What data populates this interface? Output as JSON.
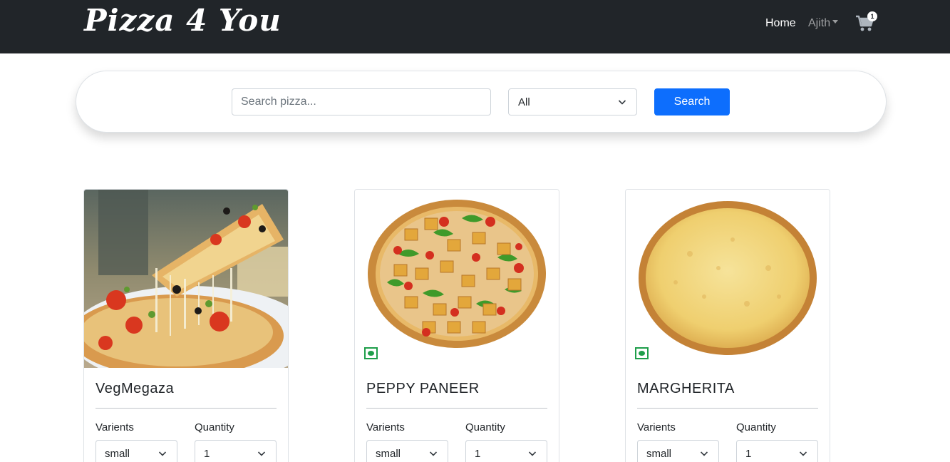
{
  "navbar": {
    "brand": "Pizza 4 You",
    "home": "Home",
    "user": "Ajith",
    "cart_count": "1"
  },
  "search": {
    "placeholder": "Search pizza...",
    "filter_value": "All",
    "button": "Search"
  },
  "labels": {
    "variants": "Varients",
    "quantity": "Quantity"
  },
  "pizzas": [
    {
      "name": "VegMegaza",
      "variant": "small",
      "quantity": "1",
      "image": "pizza-slice-photo",
      "veg_mark": false
    },
    {
      "name": "PEPPY PANEER",
      "variant": "small",
      "quantity": "1",
      "image": "paneer-pizza",
      "veg_mark": true
    },
    {
      "name": "MARGHERITA",
      "variant": "small",
      "quantity": "1",
      "image": "cheese-pizza",
      "veg_mark": true
    }
  ],
  "colors": {
    "navbar": "#212529",
    "primary": "#0d6efd",
    "veg": "#1e9e4a"
  }
}
